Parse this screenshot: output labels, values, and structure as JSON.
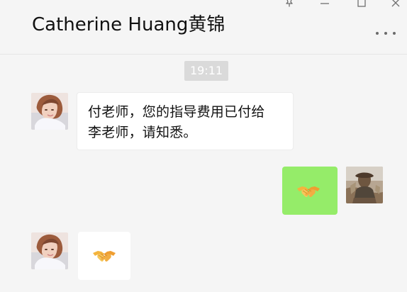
{
  "header": {
    "title": "Catherine Huang黄锦"
  },
  "chat": {
    "time": "19:11",
    "messages": [
      {
        "sender": "left",
        "line1": "付老师，您的指导费用已付给",
        "line2": "李老师，请知悉。"
      },
      {
        "sender": "right",
        "content": "handshake-icon"
      },
      {
        "sender": "left",
        "content": "handshake-icon"
      }
    ]
  },
  "colors": {
    "background": "#f5f5f5",
    "outgoing_bubble": "#95ec69",
    "incoming_bubble": "#ffffff",
    "timestamp_chip": "#dadada"
  }
}
